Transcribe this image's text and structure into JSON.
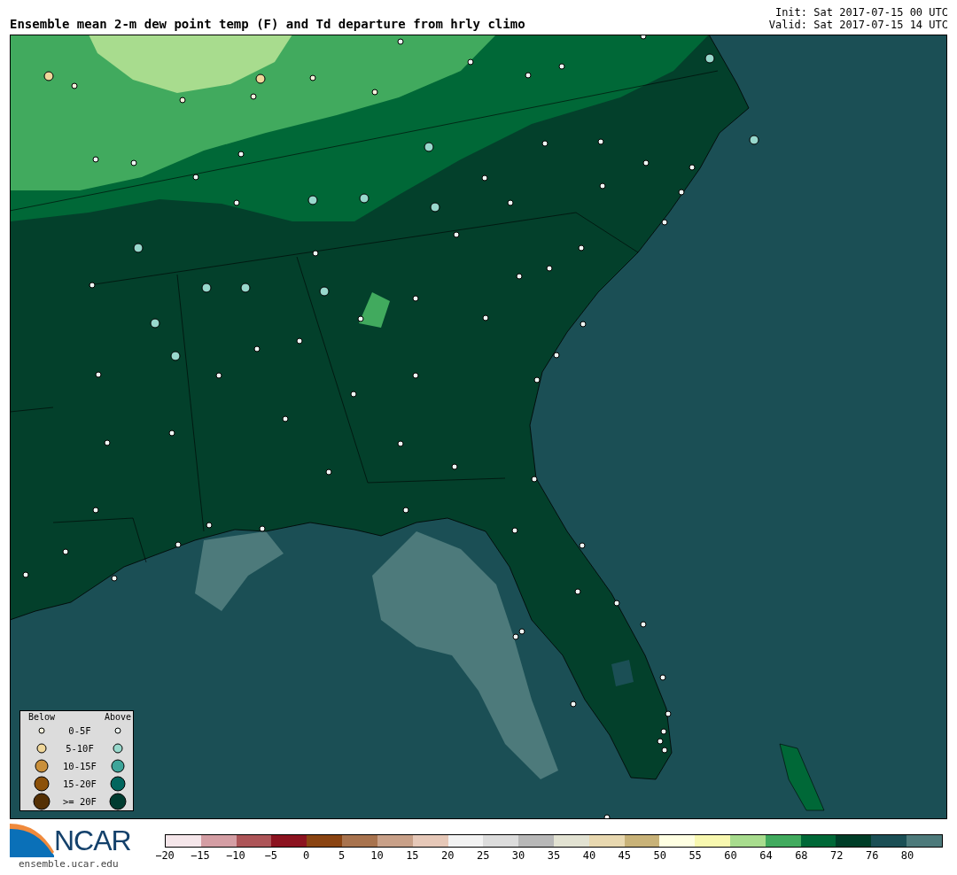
{
  "title": "Ensemble mean 2-m dew point temp (F) and Td departure from hrly climo",
  "init": "Init: Sat 2017-07-15 00 UTC",
  "valid": "Valid: Sat 2017-07-15 14 UTC",
  "legend": {
    "below_heading": "Below",
    "above_heading": "Above",
    "rows": [
      {
        "label": "0-5F"
      },
      {
        "label": "5-10F"
      },
      {
        "label": "10-15F"
      },
      {
        "label": "15-20F"
      },
      {
        "label": ">= 20F"
      }
    ]
  },
  "logo": {
    "name": "NCAR",
    "url": "ensemble.ucar.edu"
  },
  "colorbar": {
    "bins": [
      {
        "color": "#f5e6ea"
      },
      {
        "color": "#d49ea4"
      },
      {
        "color": "#ad5558"
      },
      {
        "color": "#8c1320"
      },
      {
        "color": "#8a4412"
      },
      {
        "color": "#a8734e"
      },
      {
        "color": "#c8a088"
      },
      {
        "color": "#e6c8b8"
      },
      {
        "color": "#f2f2f2"
      },
      {
        "color": "#dcdcdc"
      },
      {
        "color": "#b8b8b8"
      },
      {
        "color": "#e2e2d2"
      },
      {
        "color": "#e8d8b0"
      },
      {
        "color": "#c8b278"
      },
      {
        "color": "#ffffe2"
      },
      {
        "color": "#f8f8b0"
      },
      {
        "color": "#a8dc8e"
      },
      {
        "color": "#41aa5e"
      },
      {
        "color": "#006837"
      },
      {
        "color": "#003e28"
      },
      {
        "color": "#1b4f55"
      },
      {
        "color": "#4d7a7b"
      }
    ],
    "ticks": [
      "−20",
      "−15",
      "−10",
      "−5",
      "0",
      "5",
      "10",
      "15",
      "20",
      "25",
      "30",
      "35",
      "40",
      "45",
      "50",
      "55",
      "60",
      "64",
      "68",
      "72",
      "76",
      "80"
    ]
  }
}
